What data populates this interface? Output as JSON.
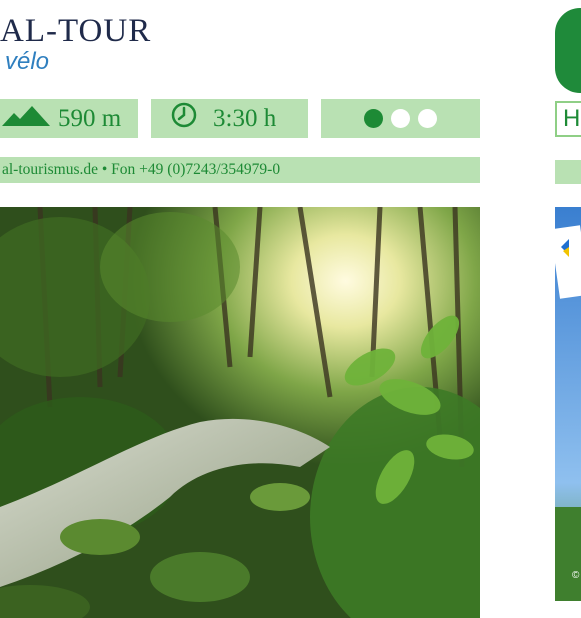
{
  "header": {
    "title": "AL-TOUR",
    "subtitle": "vélo"
  },
  "stats": {
    "elevation": "590 m",
    "duration": "3:30 h",
    "difficulty": {
      "level": 1,
      "max": 3
    }
  },
  "contact": {
    "text": "al-tourismus.de • Fon +49 (0)7243/354979-0"
  },
  "right_panel": {
    "box_letter": "H",
    "copyright": "©"
  },
  "icons": [
    "mountain-icon",
    "clock-icon",
    "difficulty-dot-icon",
    "logo-icon"
  ],
  "colors": {
    "title": "#1f2a4a",
    "subtitle": "#2f7fbf",
    "accent_green": "#1d8a35",
    "bar_green": "#b9e1b3",
    "dot_inactive": "#ffffff"
  }
}
